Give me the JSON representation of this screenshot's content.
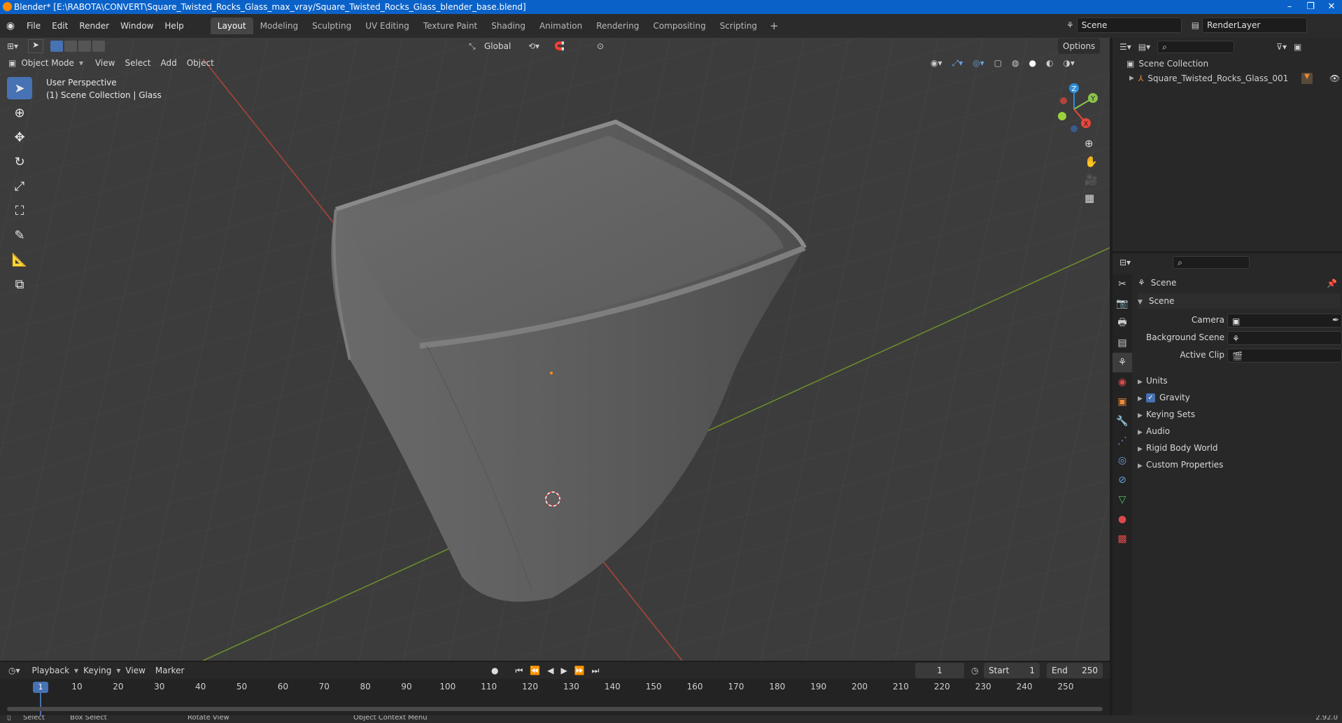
{
  "window": {
    "title": "Blender* [E:\\RABOTA\\CONVERT\\Square_Twisted_Rocks_Glass_max_vray/Square_Twisted_Rocks_Glass_blender_base.blend]"
  },
  "menu": [
    "File",
    "Edit",
    "Render",
    "Window",
    "Help"
  ],
  "workspaces": [
    "Layout",
    "Modeling",
    "Sculpting",
    "UV Editing",
    "Texture Paint",
    "Shading",
    "Animation",
    "Rendering",
    "Compositing",
    "Scripting"
  ],
  "scene_field": "Scene",
  "view_layer_field": "RenderLayer",
  "viewport": {
    "mode": "Object Mode",
    "header_menus": [
      "View",
      "Select",
      "Add",
      "Object"
    ],
    "orientation": "Global",
    "options_label": "Options",
    "overlay_line1": "User Perspective",
    "overlay_line2": "(1) Scene Collection | Glass",
    "gizmo_axes": {
      "z": "Z",
      "y": "Y",
      "x": "X"
    }
  },
  "outliner": {
    "root": "Scene Collection",
    "items": [
      "Square_Twisted_Rocks_Glass_001"
    ]
  },
  "properties": {
    "context_title": "Scene",
    "section": "Scene",
    "fields": [
      {
        "label": "Camera",
        "value": ""
      },
      {
        "label": "Background Scene",
        "value": ""
      },
      {
        "label": "Active Clip",
        "value": ""
      }
    ],
    "panels": [
      "Units",
      "Gravity",
      "Keying Sets",
      "Audio",
      "Rigid Body World",
      "Custom Properties"
    ],
    "gravity_checked": true
  },
  "timeline": {
    "menus": [
      "Playback",
      "Keying",
      "View",
      "Marker"
    ],
    "current_frame": "1",
    "start_label": "Start",
    "start_value": "1",
    "end_label": "End",
    "end_value": "250",
    "ticks": [
      "1",
      "10",
      "20",
      "30",
      "40",
      "50",
      "60",
      "70",
      "80",
      "90",
      "100",
      "110",
      "120",
      "130",
      "140",
      "150",
      "160",
      "170",
      "180",
      "190",
      "200",
      "210",
      "220",
      "230",
      "240",
      "250"
    ]
  },
  "statusbar": {
    "select": "Select",
    "box_select": "Box Select",
    "rotate": "Rotate View",
    "context_menu": "Object Context Menu",
    "version": "2.92.0"
  },
  "colors": {
    "accent": "#4772b3",
    "titlebar": "#0a62c9",
    "x_axis": "#e8473b",
    "y_axis": "#8bc34a",
    "z_axis": "#2f8ddb"
  }
}
